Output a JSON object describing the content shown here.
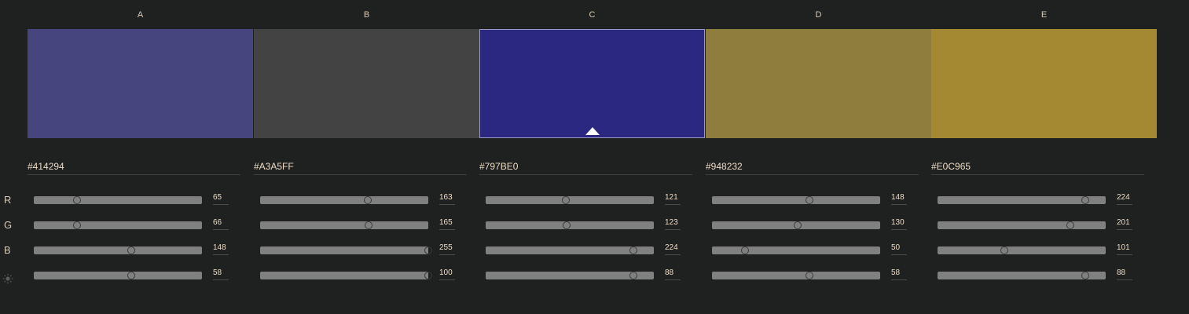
{
  "colors": [
    {
      "label": "A",
      "hex": "#414294",
      "swatch": "#46457e",
      "active": false,
      "channels": {
        "r": 65,
        "g": 66,
        "b": 148,
        "brightness": 58
      }
    },
    {
      "label": "B",
      "hex": "#A3A5FF",
      "swatch": "#424342",
      "active": false,
      "channels": {
        "r": 163,
        "g": 165,
        "b": 255,
        "brightness": 100
      }
    },
    {
      "label": "C",
      "hex": "#797BE0",
      "swatch": "#2a2880",
      "active": true,
      "channels": {
        "r": 121,
        "g": 123,
        "b": 224,
        "brightness": 88
      }
    },
    {
      "label": "D",
      "hex": "#948232",
      "swatch": "#8f7d3e",
      "active": false,
      "channels": {
        "r": 148,
        "g": 130,
        "b": 50,
        "brightness": 58
      }
    },
    {
      "label": "E",
      "hex": "#E0C965",
      "swatch": "#a48932",
      "active": false,
      "channels": {
        "r": 224,
        "g": 201,
        "b": 101,
        "brightness": 88
      }
    }
  ],
  "rows": [
    {
      "key": "r",
      "label": "R",
      "max": 255
    },
    {
      "key": "g",
      "label": "G",
      "max": 255
    },
    {
      "key": "b",
      "label": "B",
      "max": 255
    },
    {
      "key": "brightness",
      "icon": "brightness-icon",
      "max": 100
    }
  ]
}
